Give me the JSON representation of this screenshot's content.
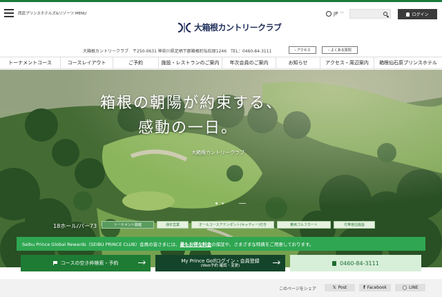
{
  "header": {
    "menu_label": "西武プリンスホテルズ&リゾーツ MENU",
    "logo_text": "大箱根カントリークラブ",
    "lang": "JP",
    "login_label": "ログイン"
  },
  "info": {
    "address": "大箱根カントリークラブ　〒250-0631 神奈川県足柄下郡箱根町仙石原1246　TEL：0460-84-3111",
    "access_label": "アクセス",
    "faq_label": "よくある質問"
  },
  "nav": [
    "トーナメントコース",
    "コースレイアウト",
    "ご予約",
    "施設・レストランのご案内",
    "年次会員のご案内",
    "お知らせ",
    "アクセス・周辺案内",
    "箱根仙石原プリンスホテル"
  ],
  "hero": {
    "title_line1": "箱根の朝陽が約束する、",
    "title_line2": "感動の一日。",
    "subtitle": "大箱根カントリークラブ",
    "holes_par": "18ホール/パー73",
    "tags": [
      "トーナメント開催",
      "通年営業",
      "オールコースアテンダント(キャディー)付き",
      "乗用ゴルフカート",
      "付帯宿泊施設"
    ]
  },
  "rewards": {
    "prefix": "Seibu Prince Global Rewards（SEIBU PRINCE CLUB）会員の皆さまには、",
    "link": "最もお得な料金",
    "suffix": "の保証や、さまざまな特典をご用意しております。"
  },
  "cta": {
    "search_label": "コースの空き枠検索・予約",
    "login_line1": "My Prince Golfログイン・会員登録",
    "login_line2": "(Web予約 確認・変更)",
    "phone": "0460-84-3111"
  },
  "share": {
    "label": "このページをシェア",
    "post": "Post",
    "facebook": "Facebook",
    "line": "LINE"
  },
  "colors": {
    "brand_green": "#2fa652",
    "dark_green": "#14452a",
    "navy_logo": "#1f2d5a"
  }
}
